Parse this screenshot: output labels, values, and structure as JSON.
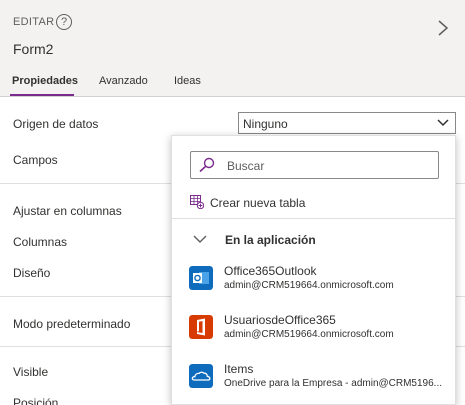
{
  "header": {
    "edit_label": "EDITAR",
    "help_glyph": "?",
    "form_name": "Form2"
  },
  "tabs": [
    {
      "label": "Propiedades",
      "active": true
    },
    {
      "label": "Avanzado",
      "active": false
    },
    {
      "label": "Ideas",
      "active": false
    }
  ],
  "properties": {
    "data_source": "Origen de datos",
    "fields": "Campos",
    "snap_to_columns": "Ajustar en columnas",
    "columns": "Columnas",
    "layout": "Diseño",
    "default_mode": "Modo predeterminado",
    "visible": "Visible",
    "position": "Posición"
  },
  "data_source_select": {
    "value": "Ninguno"
  },
  "dropdown": {
    "search_placeholder": "Buscar",
    "create_table_label": "Crear nueva tabla",
    "section_label": "En la aplicación",
    "items": [
      {
        "title": "Office365Outlook",
        "subtitle": "admin@CRM519664.onmicrosoft.com",
        "icon": "outlook-icon",
        "color": "#0f6cbd"
      },
      {
        "title": "UsuariosdeOffice365",
        "subtitle": "admin@CRM519664.onmicrosoft.com",
        "icon": "office-icon",
        "color": "#d83b01"
      },
      {
        "title": "Items",
        "subtitle": "OneDrive para la Empresa - admin@CRM5196...",
        "icon": "onedrive-icon",
        "color": "#0f6cbd"
      }
    ]
  },
  "colors": {
    "accent": "#7b2b8c",
    "header_bg": "#f3f2f1"
  }
}
